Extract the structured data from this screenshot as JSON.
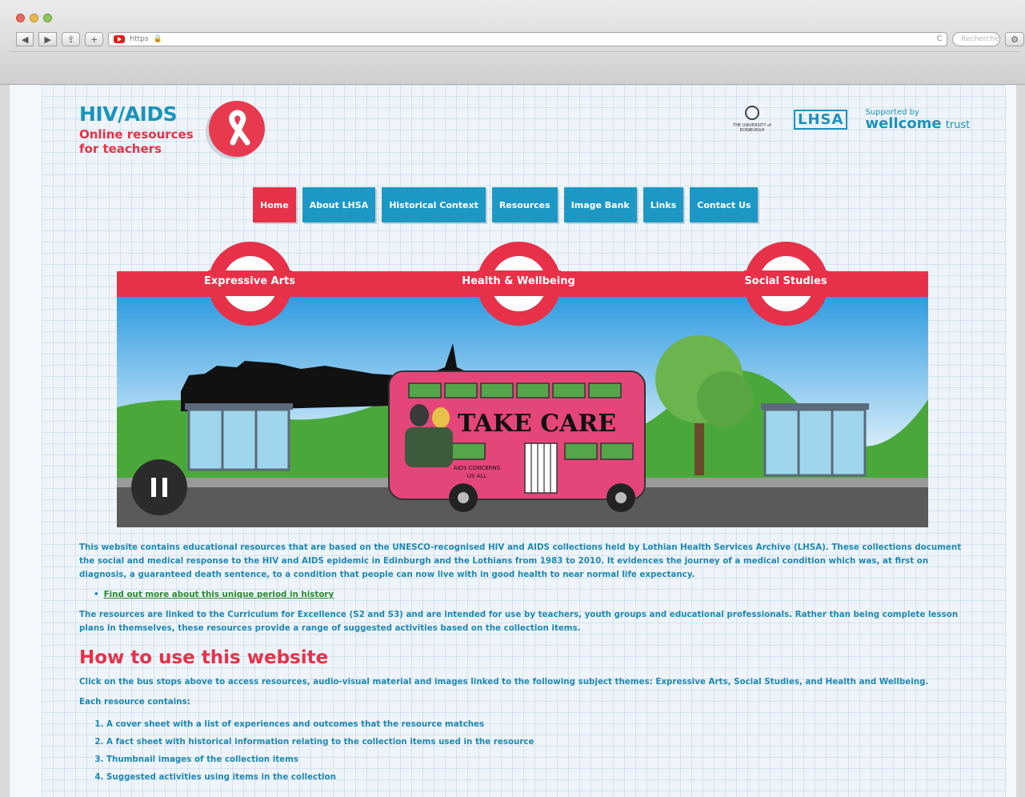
{
  "browser": {
    "url_text": "https",
    "search_placeholder": "Rechercher",
    "back_label": "◀",
    "forward_label": "▶",
    "share_label": "⇪",
    "add_label": "+",
    "reload_label": "C",
    "settings_label": "⚙"
  },
  "header": {
    "title": "HIV/AIDS",
    "subtitle": "Online resources for teachers",
    "partners": {
      "uoe_text": "THE UNIVERSITY of EDINBURGH",
      "lhsa_text": "LHSA",
      "wellcome_supported": "Supported by",
      "wellcome_name": "wellcome",
      "wellcome_trust": "trust"
    }
  },
  "nav": {
    "items": [
      {
        "label": "Home",
        "active": true
      },
      {
        "label": "About LHSA"
      },
      {
        "label": "Historical Context"
      },
      {
        "label": "Resources"
      },
      {
        "label": "Image Bank"
      },
      {
        "label": "Links"
      },
      {
        "label": "Contact Us"
      }
    ]
  },
  "hero": {
    "stops": [
      "Expressive Arts",
      "Health & Wellbeing",
      "Social Studies"
    ],
    "bus_text": "TAKE CARE",
    "bus_subtext_1": "AIDS CONCERNS",
    "bus_subtext_2": "US ALL",
    "colors": {
      "accent": "#e73148",
      "blue": "#1d98c4",
      "sky": "#38a8e6",
      "grass": "#4aa83b"
    }
  },
  "content": {
    "intro": "This website contains educational resources that are based on the UNESCO-recognised HIV and AIDS collections held by Lothian Health Services Archive (LHSA). These collections document the social and medical response to the HIV and AIDS epidemic in Edinburgh and the Lothians from 1983 to 2010. It evidences the journey of a medical condition which was, at first on diagnosis, a guaranteed death sentence, to a condition that people can now live with in good health to near normal life expectancy.",
    "link": "Find out more about this unique period in history",
    "para2": "The resources are linked to the Curriculum for Excellence (S2 and S3) and are intended for use by teachers, youth groups and educational professionals. Rather than being complete lesson plans in themselves, these resources provide a range of suggested activities based on the collection items.",
    "heading": "How to use this website",
    "para3": "Click on the bus stops above to access resources, audio-visual material and images linked to the following subject themes: Expressive Arts, Social Studies, and Health and Wellbeing.",
    "para4": "Each resource contains:",
    "list": [
      "A cover sheet with a list of experiences and outcomes that the resource matches",
      "A fact sheet with historical information relating to the collection items used in the resource",
      "Thumbnail images of the collection items",
      "Suggested activities using items in the collection"
    ]
  }
}
